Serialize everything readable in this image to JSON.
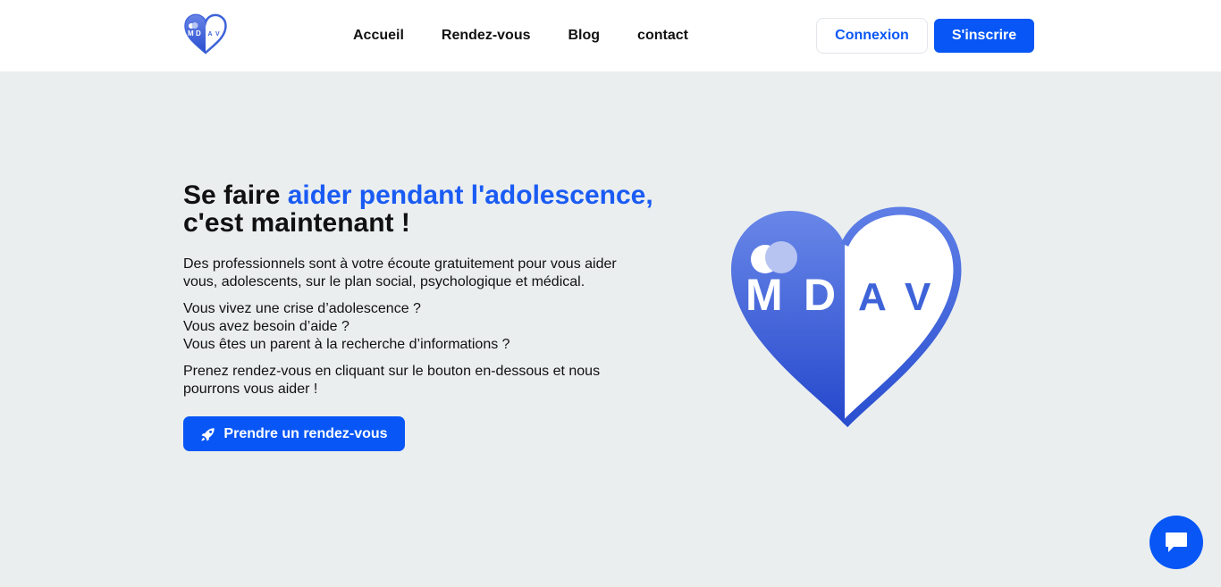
{
  "nav": {
    "items": [
      {
        "label": "Accueil"
      },
      {
        "label": "Rendez-vous"
      },
      {
        "label": "Blog"
      },
      {
        "label": "contact"
      }
    ],
    "login_label": "Connexion",
    "signup_label": "S'inscrire"
  },
  "logo": {
    "text_m": "M",
    "text_d": "D",
    "text_a": "A",
    "text_v": "V"
  },
  "hero": {
    "title_start": "Se faire ",
    "title_accent": "aider pendant l'adolescence,",
    "title_end": "c'est maintenant !",
    "paragraph1": "Des professionnels sont à votre écoute gratuitement pour vous aider vous, adolescents, sur le plan social, psychologique et médical.",
    "question1": "Vous vivez une crise d’adolescence ?",
    "question2": "Vous avez besoin d’aide ?",
    "question3": "Vous êtes un parent à la recherche d’informations ?",
    "paragraph3": "Prenez rendez-vous en cliquant sur le bouton en-dessous et nous pourrons vous aider !",
    "cta_label": "Prendre un rendez-vous",
    "cta_icon": "rocket-icon"
  },
  "chat": {
    "icon": "chat-bubble-icon"
  },
  "colors": {
    "primary": "#0756f5",
    "accent_text": "#1a5bf4",
    "background": "#eaeeef",
    "logo_dark": "#2a4fd0",
    "logo_light": "#5f7ee2"
  }
}
